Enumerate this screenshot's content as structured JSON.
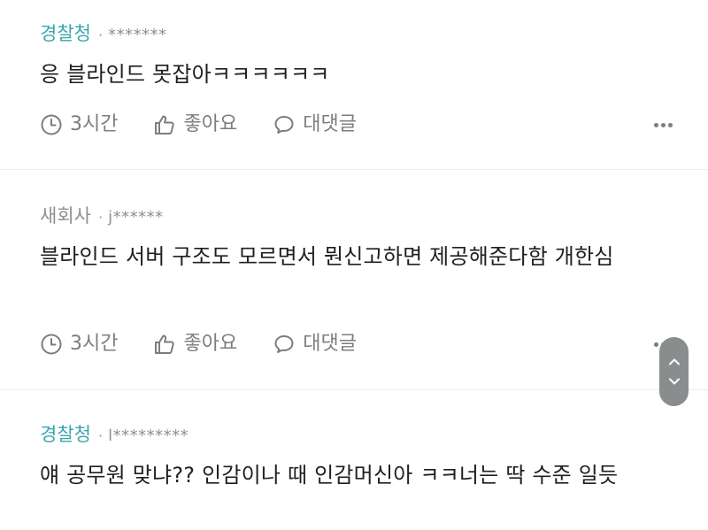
{
  "comments": [
    {
      "company": "경찰청",
      "separator": "·",
      "user": "*******",
      "text": "응 블라인드 못잡아ㅋㅋㅋㅋㅋㅋ",
      "time": "3시간",
      "like_label": "좋아요",
      "reply_label": "대댓글"
    },
    {
      "company": "새회사",
      "separator": "·",
      "user": "j******",
      "text": "블라인드 서버 구조도 모르면서 뭔신고하면 제공해준다함 개한심",
      "time": "3시간",
      "like_label": "좋아요",
      "reply_label": "대댓글"
    },
    {
      "company": "경찰청",
      "separator": "·",
      "user": "l*********",
      "text": "얘 공무원 맞냐?? 인감이나 때 인감머신아 ㅋㅋ너는 딱 수준 일듯"
    }
  ],
  "colors": {
    "accent": "#3aa5ad",
    "muted": "#8f8f8f",
    "scroll_widget": "#8a8d8e"
  },
  "icons": {
    "time": "clock-icon",
    "like": "thumbs-up-icon",
    "reply": "speech-bubble-icon",
    "more": "more-dots-icon",
    "scroll_up": "chevron-up-icon",
    "scroll_down": "chevron-down-icon"
  }
}
